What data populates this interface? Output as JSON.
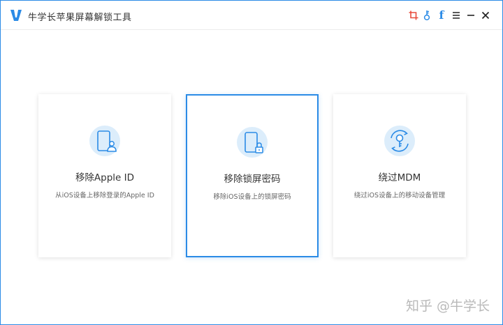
{
  "app": {
    "title": "牛学长苹果屏幕解锁工具"
  },
  "toolbar": {
    "facebook_label": "f",
    "menu_label": "≡",
    "minimize_label": "—",
    "close_label": "✕"
  },
  "icons": {
    "app_logo": "niu-logo-icon",
    "crop": "crop-icon",
    "key": "key-icon",
    "facebook": "facebook-icon",
    "menu": "menu-icon",
    "minimize": "minimize-icon",
    "close": "close-icon"
  },
  "colors": {
    "accent": "#2b8be6",
    "crop_icon": "#e84c3d",
    "icon_bg": "#dcedfb"
  },
  "cards": [
    {
      "title": "移除Apple ID",
      "desc": "从iOS设备上移除登录的Apple ID",
      "icon": "phone-user-icon",
      "selected": false
    },
    {
      "title": "移除锁屏密码",
      "desc": "移除iOS设备上的锁屏密码",
      "icon": "phone-lock-icon",
      "selected": true
    },
    {
      "title": "绕过MDM",
      "desc": "绕过iOS设备上的移动设备管理",
      "icon": "key-cycle-icon",
      "selected": false
    }
  ],
  "watermark": "知乎 @牛学长"
}
